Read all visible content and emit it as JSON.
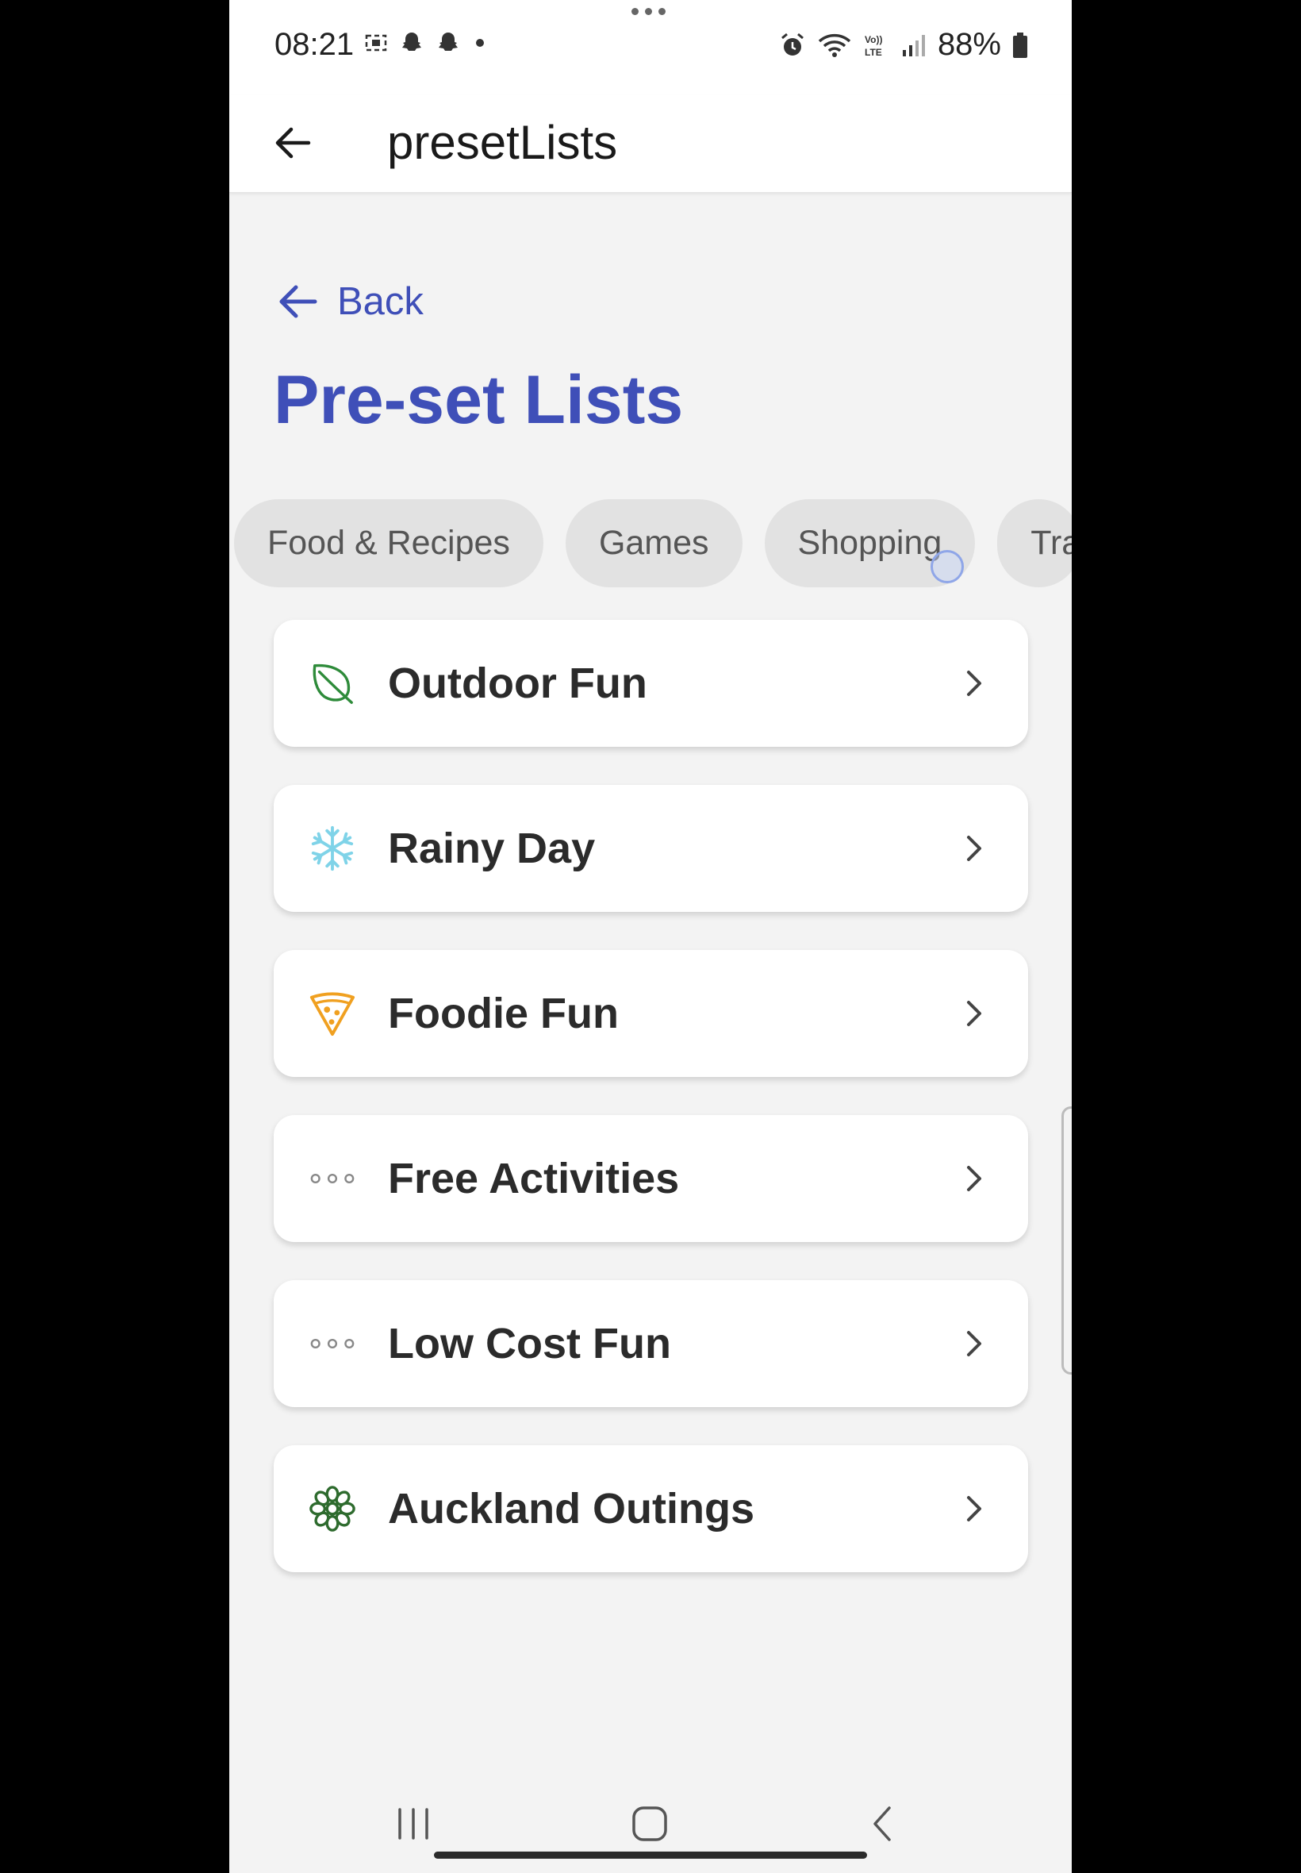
{
  "status_bar": {
    "time": "08:21",
    "battery": "88%",
    "left_icons": [
      "screen-record-icon",
      "snapchat-icon",
      "snapchat-icon",
      "dot-icon"
    ],
    "right_icons": [
      "alarm-icon",
      "wifi-icon",
      "volte-icon",
      "signal-icon",
      "battery-icon"
    ]
  },
  "app_bar": {
    "title": "presetLists",
    "back_icon": "arrow-left-icon"
  },
  "content": {
    "back_link_label": "Back",
    "page_title": "Pre-set Lists",
    "chips": [
      "Food & Recipes",
      "Games",
      "Shopping",
      "Tra"
    ],
    "cards": [
      {
        "label": "Outdoor Fun",
        "icon": "leaf-icon",
        "icon_color": "#2e8b3a"
      },
      {
        "label": "Rainy Day",
        "icon": "snowflake-icon",
        "icon_color": "#7fd3e8"
      },
      {
        "label": "Foodie Fun",
        "icon": "pizza-icon",
        "icon_color": "#f0a020"
      },
      {
        "label": "Free Activities",
        "icon": "more-dots-icon",
        "icon_color": "#888888"
      },
      {
        "label": "Low Cost Fun",
        "icon": "more-dots-icon",
        "icon_color": "#888888"
      },
      {
        "label": "Auckland Outings",
        "icon": "flower-icon",
        "icon_color": "#2e6b2e"
      }
    ]
  },
  "colors": {
    "accent": "#3f4fb8",
    "background": "#f3f3f3",
    "card": "#ffffff",
    "chip": "#e2e2e2"
  }
}
